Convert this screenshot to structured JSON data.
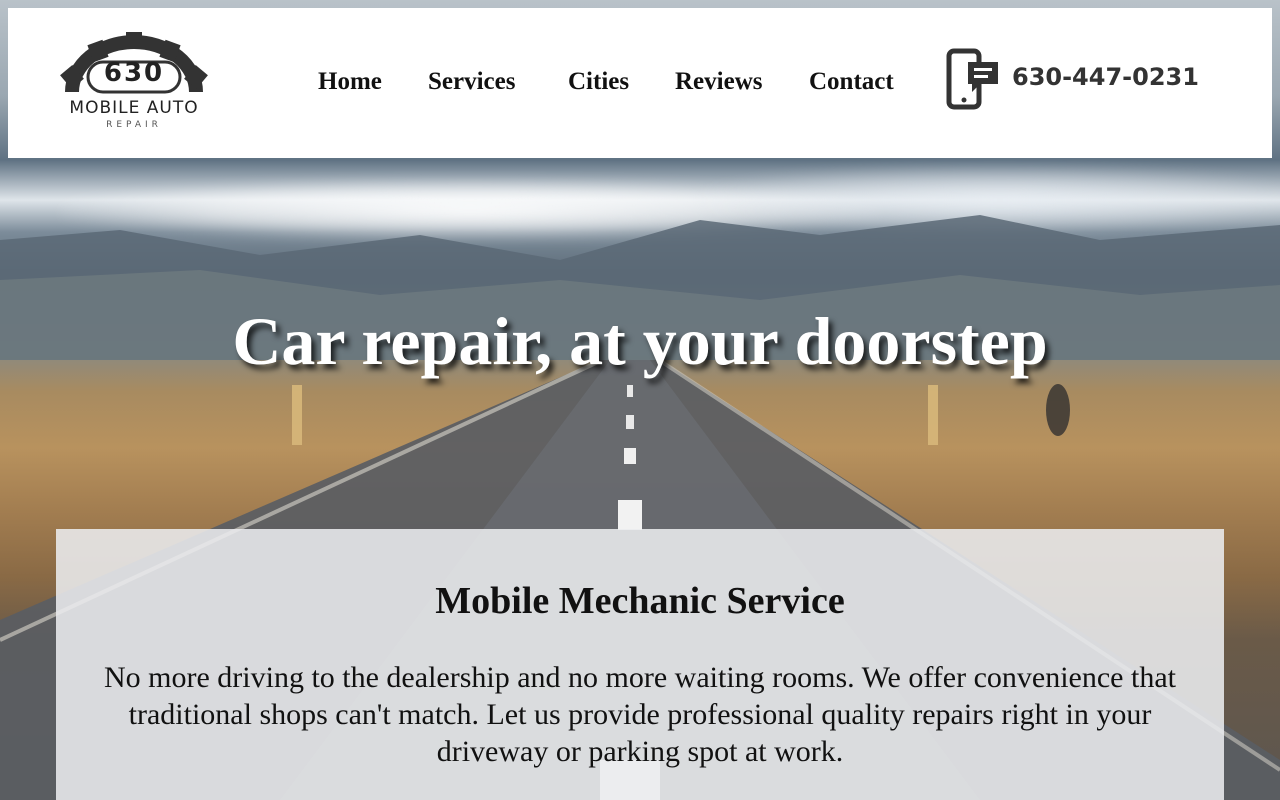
{
  "logo": {
    "number": "630",
    "name": "MOBILE AUTO",
    "tagline": "REPAIR"
  },
  "nav": {
    "items": [
      {
        "label": "Home"
      },
      {
        "label": "Services"
      },
      {
        "label": "Cities"
      },
      {
        "label": "Reviews"
      },
      {
        "label": "Contact"
      }
    ]
  },
  "contact": {
    "phone": "630-447-0231",
    "icon": "phone-chat-icon"
  },
  "hero": {
    "title": "Car repair, at your doorstep"
  },
  "info": {
    "title": "Mobile Mechanic Service",
    "text": "No more driving to the dealership and no more waiting rooms. We offer convenience that traditional shops can't match. Let us provide professional quality repairs right in your driveway or parking spot at work."
  },
  "colors": {
    "header_bg": "#ffffff",
    "nav_text": "#111111",
    "card_bg": "#ebecee"
  }
}
